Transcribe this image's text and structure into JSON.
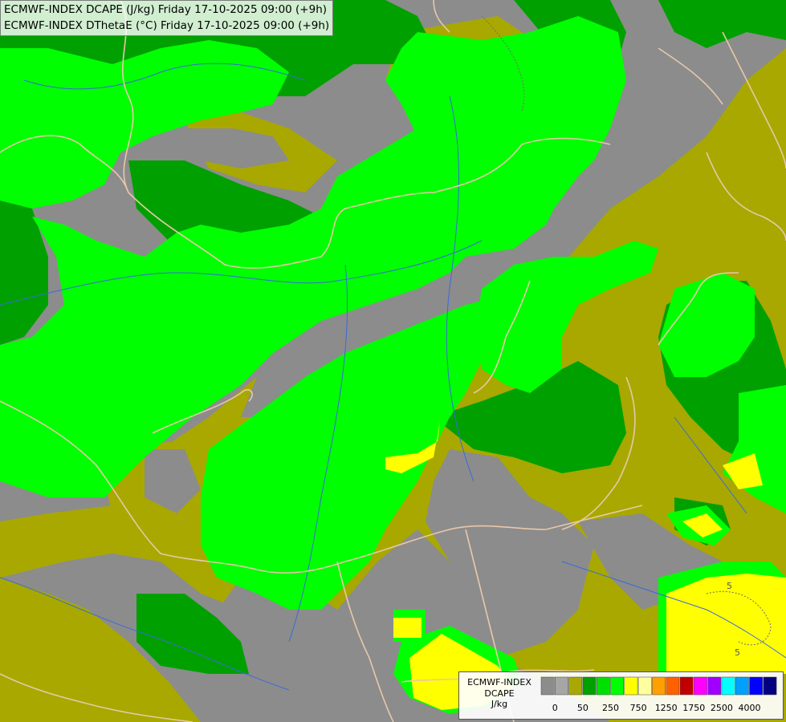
{
  "header": {
    "title_line1": "ECMWF-INDEX DCAPE (J/kg) Friday 17-10-2025 09:00 (+9h)",
    "title_line2": "ECMWF-INDEX DThetaE (°C) Friday 17-10-2025 09:00 (+9h)"
  },
  "map": {
    "contour_labels": [
      "5",
      "5"
    ]
  },
  "legend": {
    "line1": "ECMWF-INDEX",
    "line2": "DCAPE",
    "line3": "J/kg",
    "colors": [
      "#8c8c8c",
      "#a6a6a6",
      "#a8a800",
      "#00a000",
      "#00e000",
      "#00ff00",
      "#ffff00",
      "#ffffa0",
      "#ffa000",
      "#ff6000",
      "#c00000",
      "#ff00ff",
      "#a000ff",
      "#00ffff",
      "#00a0ff",
      "#0000ff",
      "#000080"
    ],
    "ticks": [
      "0",
      "50",
      "250",
      "750",
      "1250",
      "1750",
      "2500",
      "4000"
    ]
  }
}
